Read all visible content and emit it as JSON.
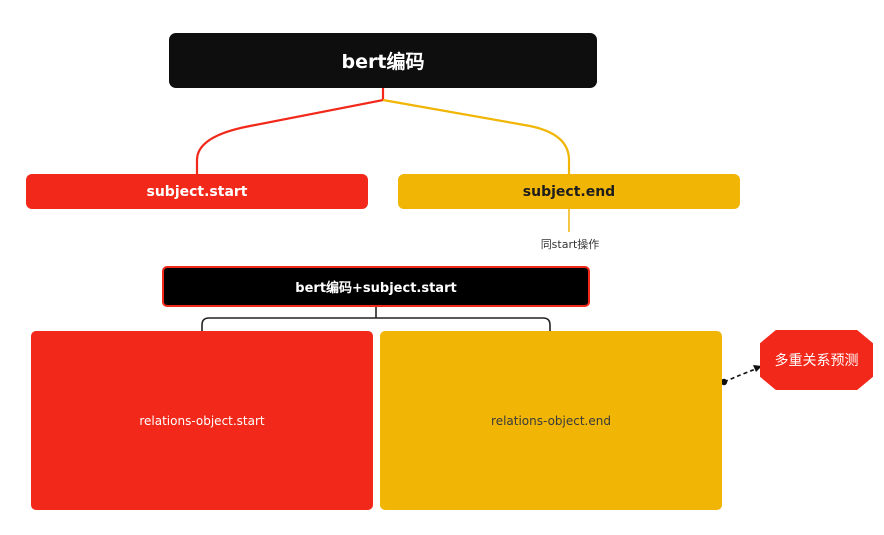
{
  "colors": {
    "dark": "#0e0e0e",
    "red": "#f2281a",
    "yellow": "#f0b505",
    "white": "#ffffff"
  },
  "nodes": {
    "root": "bert编码",
    "subject_start": "subject.start",
    "subject_end": "subject.end",
    "same_op_note": "同start操作",
    "combined": "bert编码+subject.start",
    "relations_start": "relations-object.start",
    "relations_end": "relations-object.end",
    "multi_relation": "多重关系预测"
  }
}
